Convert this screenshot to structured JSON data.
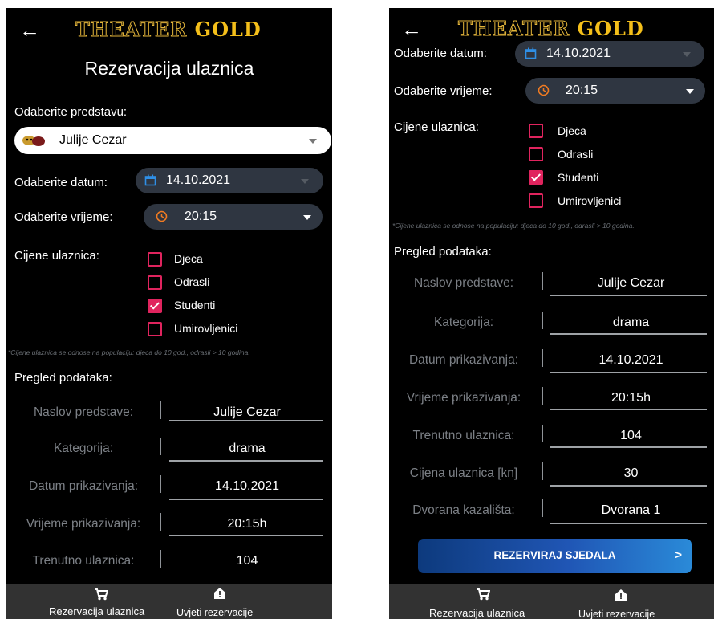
{
  "app": {
    "logo_part1": "THEATER",
    "logo_part2": "GOLD",
    "page_title": "Rezervacija ulaznica"
  },
  "form": {
    "show_label": "Odaberite predstavu:",
    "show_value": "Julije Cezar",
    "date_label": "Odaberite datum:",
    "date_value": "14.10.2021",
    "time_label": "Odaberite vrijeme:",
    "time_value": "20:15",
    "prices_label": "Cijene ulaznica:",
    "ticket_types": [
      {
        "label": "Djeca",
        "checked": false
      },
      {
        "label": "Odrasli",
        "checked": false
      },
      {
        "label": "Studenti",
        "checked": true
      },
      {
        "label": "Umirovljenici",
        "checked": false
      }
    ],
    "note": "*Cijene ulaznica se odnose na populaciju: djeca do 10 god., odrasli > 10 godina."
  },
  "summary": {
    "title": "Pregled podataka:",
    "rows": [
      {
        "label": "Naslov predstave:",
        "value": "Julije Cezar"
      },
      {
        "label": "Kategorija:",
        "value": "drama"
      },
      {
        "label": "Datum prikazivanja:",
        "value": "14.10.2021"
      },
      {
        "label": "Vrijeme prikazivanja:",
        "value": "20:15h"
      },
      {
        "label": "Trenutno ulaznica:",
        "value": "104"
      },
      {
        "label": "Cijena ulaznica [kn]",
        "value": "30"
      },
      {
        "label": "Dvorana kazališta:",
        "value": "Dvorana 1"
      }
    ]
  },
  "actions": {
    "reserve_label": "REZERVIRAJ SJEDALA"
  },
  "nav": {
    "tab1_label": "Rezervacija ulaznica",
    "tab2_label": "Uvjeti rezervacije"
  },
  "colors": {
    "checkbox": "#e0245e",
    "logo_gold": "#f4bf1a",
    "button_start": "#0d3a7d",
    "button_end": "#2a8ad8",
    "nav_bg": "#323232"
  },
  "icons": [
    "back-arrow-icon",
    "masks-icon",
    "calendar-icon",
    "clock-icon",
    "chevron-down-icon",
    "cart-icon",
    "alert-home-icon",
    "chevron-right-icon"
  ]
}
